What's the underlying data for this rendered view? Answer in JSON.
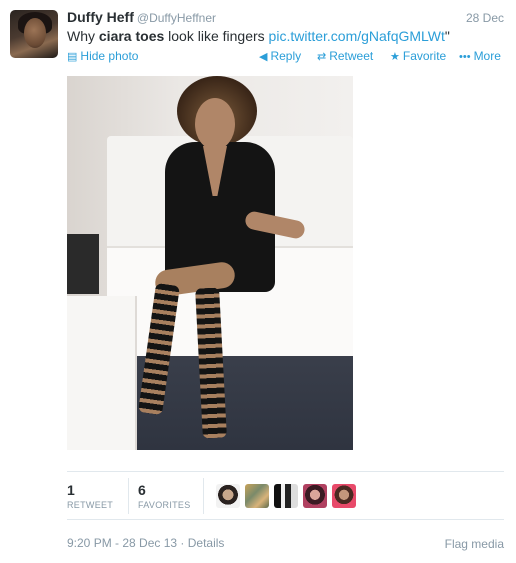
{
  "tweet": {
    "fullname": "Duffy Heff",
    "username": "@DuffyHeffner",
    "time": "28 Dec",
    "text_prefix": "Why ",
    "text_bold": "ciara toes",
    "text_middle": " look like fingers ",
    "text_link": "pic.twitter.com/gNafqGMLWt",
    "text_suffix": "\""
  },
  "actions": {
    "hide_photo": "Hide photo",
    "reply": "Reply",
    "retweet": "Retweet",
    "favorite": "Favorite",
    "more": "More"
  },
  "icons": {
    "hide_photo": "photo-icon",
    "reply": "reply-arrow-icon",
    "retweet": "retweet-icon",
    "favorite": "star-icon",
    "more": "ellipsis-icon"
  },
  "stats": {
    "retweets_count": "1",
    "retweets_label": "RETWEET",
    "favorites_count": "6",
    "favorites_label": "FAVORITES"
  },
  "footer": {
    "timestamp": "9:20 PM - 28 Dec 13",
    "separator": " · ",
    "details": "Details",
    "flag_media": "Flag media"
  },
  "colors": {
    "link": "#2b9ed8",
    "muted": "#8899a6",
    "text": "#292f33"
  }
}
